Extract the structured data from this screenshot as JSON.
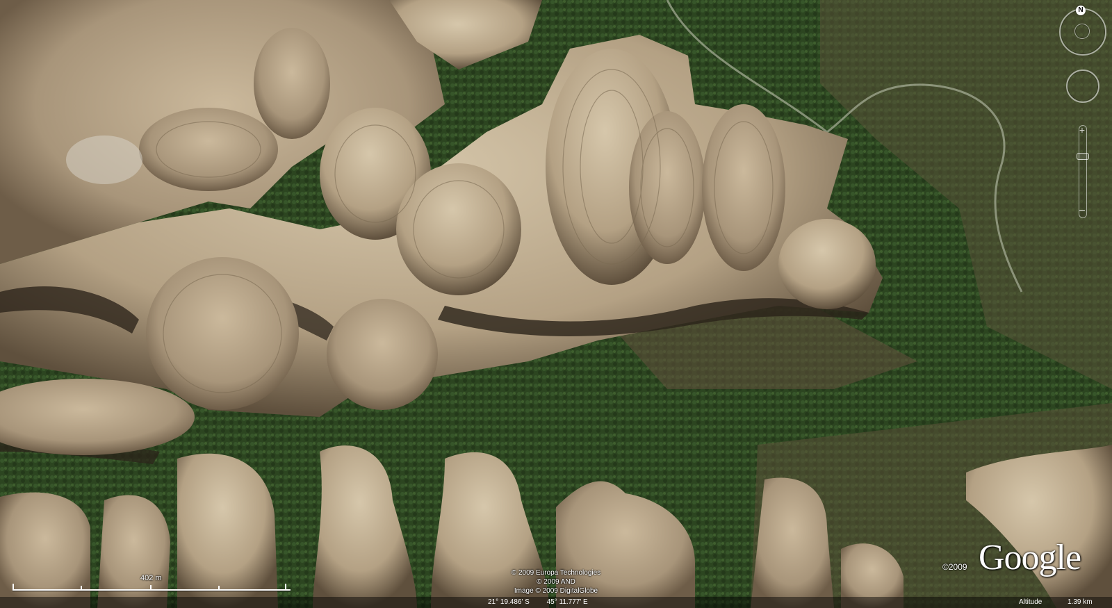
{
  "map": {
    "type": "satellite",
    "description_region": "sandstone ridges"
  },
  "navigation": {
    "north_label": "N",
    "compass_icon": "compass-icon",
    "look_icon": "look-joystick-icon",
    "zoom_in_label": "+",
    "zoom_out_label": "−",
    "zoom_level": 0.28
  },
  "scale": {
    "label": "402 m"
  },
  "attribution": {
    "line1": "© 2009 Europa Technologies",
    "line2": "© 2009 AND",
    "line3": "Image © 2009 DigitalGlobe"
  },
  "logo": {
    "copyright": "©2009",
    "brand": "Google"
  },
  "status": {
    "latitude": "21° 19.486' S",
    "longitude": "45° 11.777' E",
    "altitude_label": "Altitude",
    "altitude_value": "1.39 km"
  },
  "colors": {
    "vegetation": "#2f4a22",
    "rock": "#b8a68a",
    "shadow": "#3b3124"
  }
}
